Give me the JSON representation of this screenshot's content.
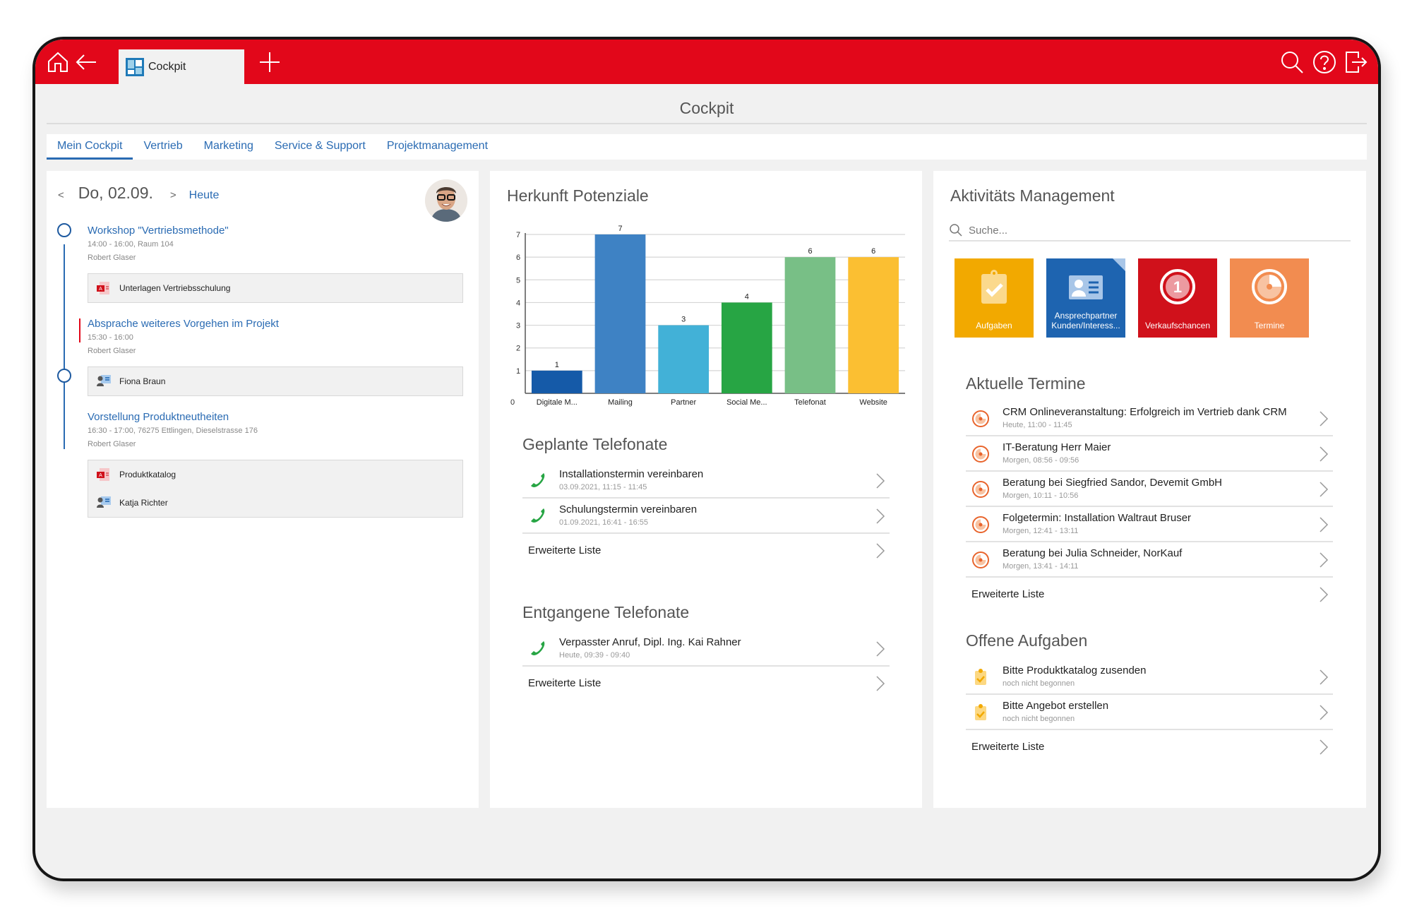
{
  "topbar": {
    "icons": [
      "home-icon",
      "back-arrow-icon",
      "add-tab-icon",
      "search-icon",
      "help-icon",
      "logout-icon"
    ],
    "active_tab": "Cockpit",
    "color": "#e2071a"
  },
  "page": {
    "title": "Cockpit"
  },
  "nav": {
    "tabs": [
      {
        "label": "Mein Cockpit",
        "active": true
      },
      {
        "label": "Vertrieb"
      },
      {
        "label": "Marketing"
      },
      {
        "label": "Service & Support"
      },
      {
        "label": "Projektmanagement"
      }
    ]
  },
  "calendar": {
    "prev": "<",
    "date": "Do, 02.09.",
    "next": ">",
    "today": "Heute",
    "events": [
      {
        "title": "Workshop \"Vertriebsmethode\"",
        "time": "14:00 - 16:00, Raum 104",
        "owner": "Robert Glaser",
        "attachments": [
          {
            "type": "pdf-icon",
            "label": "Unterlagen Vertriebsschulung"
          }
        ]
      },
      {
        "title": "Absprache weiteres Vorgehen im Projekt",
        "time": "15:30 - 16:00",
        "owner": "Robert Glaser",
        "attachments": [
          {
            "type": "contact-card-icon",
            "label": "Fiona Braun"
          }
        ]
      },
      {
        "title": "Vorstellung Produktneutheiten",
        "time": "16:30 - 17:00, 76275 Ettlingen, Dieselstrasse 176",
        "owner": "Robert Glaser",
        "attachments": [
          {
            "type": "pdf-icon",
            "label": "Produktkatalog"
          },
          {
            "type": "contact-card-icon",
            "label": "Katja Richter"
          }
        ]
      }
    ]
  },
  "potenziale": {
    "title": "Herkunft Potenziale"
  },
  "chart_data": {
    "type": "bar",
    "title": "Herkunft Potenziale",
    "categories": [
      "Digitale M...",
      "Mailing",
      "Partner",
      "Social Me...",
      "Telefonat",
      "Website"
    ],
    "values": [
      1,
      7,
      3,
      4,
      6,
      6
    ],
    "colors": [
      "#155aa8",
      "#3e82c4",
      "#42b1d7",
      "#27a544",
      "#78bf86",
      "#fbbf32"
    ],
    "data_labels": true,
    "xlabel": "",
    "ylabel": "",
    "ylim": [
      0,
      7
    ],
    "yticks": [
      0,
      1,
      2,
      3,
      4,
      5,
      6,
      7
    ],
    "grid": true,
    "legend": "none"
  },
  "geplante": {
    "title": "Geplante Telefonate",
    "items": [
      {
        "title": "Installationstermin vereinbaren",
        "sub": "03.09.2021, 11:15 - 11:45"
      },
      {
        "title": "Schulungstermin vereinbaren",
        "sub": "01.09.2021, 16:41 - 16:55"
      }
    ],
    "more": "Erweiterte Liste"
  },
  "entgangene": {
    "title": "Entgangene Telefonate",
    "items": [
      {
        "title": "Verpasster Anruf, Dipl. Ing. Kai Rahner",
        "sub": "Heute, 09:39 - 09:40"
      }
    ],
    "more": "Erweiterte Liste"
  },
  "aktivitaet": {
    "title": "Aktivitäts Management",
    "search_placeholder": "Suche...",
    "tiles": [
      {
        "label": "Aufgaben",
        "color": "#f2a900",
        "icon": "clipboard-check-icon"
      },
      {
        "label": "Ansprechpartner Kunden/Interess...",
        "color": "#1e64b0",
        "icon": "contact-card-icon"
      },
      {
        "label": "Verkaufschancen",
        "color": "#d0111b",
        "icon": "badge-count-icon",
        "badge": "1"
      },
      {
        "label": "Termine",
        "color": "#f28c50",
        "icon": "appointment-clock-icon"
      }
    ]
  },
  "termine": {
    "title": "Aktuelle Termine",
    "items": [
      {
        "title": "CRM Onlineveranstaltung: Erfolgreich im Vertrieb dank CRM",
        "sub": "Heute, 11:00 - 11:45"
      },
      {
        "title": "IT-Beratung Herr Maier",
        "sub": "Morgen, 08:56 - 09:56"
      },
      {
        "title": "Beratung bei Siegfried Sandor, Devemit GmbH",
        "sub": "Morgen, 10:11 - 10:56"
      },
      {
        "title": "Folgetermin: Installation Waltraut Bruser",
        "sub": "Morgen, 12:41 - 13:11"
      },
      {
        "title": "Beratung bei Julia Schneider, NorKauf",
        "sub": "Morgen, 13:41 - 14:11"
      }
    ],
    "more": "Erweiterte Liste"
  },
  "aufgaben": {
    "title": "Offene Aufgaben",
    "items": [
      {
        "title": "Bitte Produktkatalog zusenden",
        "sub": "noch nicht begonnen"
      },
      {
        "title": "Bitte Angebot erstellen",
        "sub": "noch nicht begonnen"
      }
    ],
    "more": "Erweiterte Liste"
  }
}
